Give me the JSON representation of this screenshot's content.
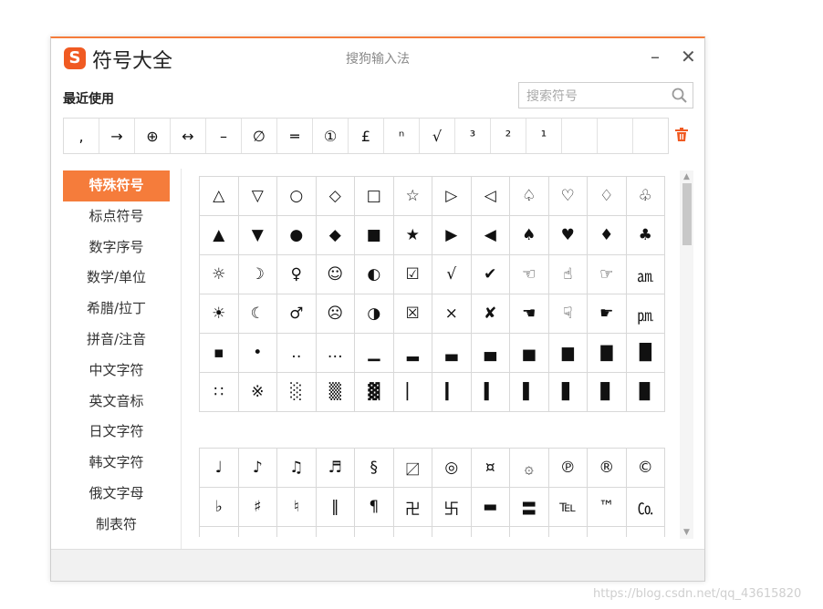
{
  "window": {
    "app_title": "符号大全",
    "logo_char": "S",
    "center_title": "搜狗输入法",
    "minimize_glyph": "–",
    "close_glyph": "✕",
    "accent_color": "#f57c3b"
  },
  "recent": {
    "label": "最近使用",
    "items": [
      ",",
      "→",
      "⊕",
      "↔",
      "–",
      "∅",
      "═",
      "①",
      "£",
      "ⁿ",
      "√",
      "³",
      "²",
      "¹",
      "",
      "",
      ""
    ]
  },
  "search": {
    "placeholder": "搜索符号",
    "value": "",
    "icon": "search-icon"
  },
  "trash_icon": "trash-icon",
  "sidebar": {
    "items": [
      {
        "label": "特殊符号",
        "active": true
      },
      {
        "label": "标点符号",
        "active": false
      },
      {
        "label": "数字序号",
        "active": false
      },
      {
        "label": "数学/单位",
        "active": false
      },
      {
        "label": "希腊/拉丁",
        "active": false
      },
      {
        "label": "拼音/注音",
        "active": false
      },
      {
        "label": "中文字符",
        "active": false
      },
      {
        "label": "英文音标",
        "active": false
      },
      {
        "label": "日文字符",
        "active": false
      },
      {
        "label": "韩文字符",
        "active": false
      },
      {
        "label": "俄文字母",
        "active": false
      },
      {
        "label": "制表符",
        "active": false
      }
    ]
  },
  "grid1": [
    [
      "△",
      "▽",
      "○",
      "◇",
      "□",
      "☆",
      "▷",
      "◁",
      "♤",
      "♡",
      "♢",
      "♧"
    ],
    [
      "▲",
      "▼",
      "●",
      "◆",
      "■",
      "★",
      "▶",
      "◀",
      "♠",
      "♥",
      "♦",
      "♣"
    ],
    [
      "☼",
      "☽",
      "♀",
      "☺",
      "◐",
      "☑",
      "√",
      "✔",
      "☜",
      "☝",
      "☞",
      "㏂"
    ],
    [
      "☀",
      "☾",
      "♂",
      "☹",
      "◑",
      "☒",
      "×",
      "✘",
      "☚",
      "☟",
      "☛",
      "㏘"
    ],
    [
      "▪",
      "•",
      "‥",
      "…",
      "▁",
      "▂",
      "▃",
      "▄",
      "▅",
      "▆",
      "▇",
      "█"
    ],
    [
      "∷",
      "※",
      "░",
      "▒",
      "▓",
      "▏",
      "▎",
      "▍",
      "▌",
      "▋",
      "▊",
      "▉"
    ]
  ],
  "grid2": [
    [
      "♩",
      "♪",
      "♫",
      "♬",
      "§",
      "〼",
      "◎",
      "¤",
      "۞",
      "℗",
      "®",
      "©"
    ],
    [
      "♭",
      "♯",
      "♮",
      "‖",
      "¶",
      "卍",
      "卐",
      "▬",
      "〓",
      "℡",
      "™",
      "㏇"
    ],
    [
      "",
      "",
      "",
      "",
      "",
      "",
      "",
      "",
      "",
      "",
      "",
      ""
    ]
  ],
  "scrollbar": {
    "up": "▲",
    "down": "▼"
  },
  "watermark": "https://blog.csdn.net/qq_43615820"
}
